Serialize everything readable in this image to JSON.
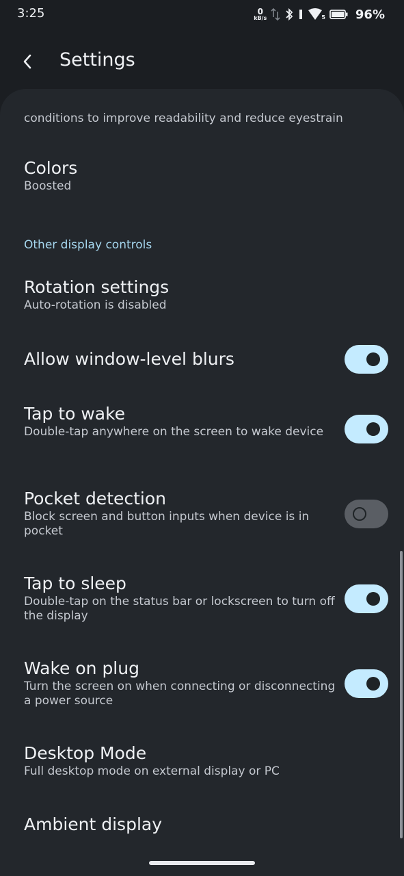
{
  "status_bar": {
    "time": "3:25",
    "net_speed_value": "0",
    "net_speed_unit": "kB/s",
    "signal_label": "5",
    "battery_percent": "96%"
  },
  "header": {
    "title": "Settings"
  },
  "top_description": "conditions to improve readability and reduce eyestrain",
  "items": {
    "colors": {
      "title": "Colors",
      "summary": "Boosted"
    },
    "section_other": "Other display controls",
    "rotation": {
      "title": "Rotation settings",
      "summary": "Auto-rotation is disabled"
    },
    "blurs": {
      "title": "Allow window-level blurs",
      "enabled": true
    },
    "tap_to_wake": {
      "title": "Tap to wake",
      "summary": "Double-tap anywhere on the screen to wake device",
      "enabled": true
    },
    "pocket": {
      "title": "Pocket detection",
      "summary": "Block screen and button inputs when device is in pocket",
      "enabled": false
    },
    "tap_to_sleep": {
      "title": "Tap to sleep",
      "summary": "Double-tap on the status bar or lockscreen to turn off the display",
      "enabled": true
    },
    "wake_on_plug": {
      "title": "Wake on plug",
      "summary": "Turn the screen on when connecting or disconnecting a power source",
      "enabled": true
    },
    "desktop_mode": {
      "title": "Desktop Mode",
      "summary": "Full desktop mode on external display or PC"
    },
    "ambient": {
      "title": "Ambient display"
    }
  },
  "colors": {
    "background": "#1b1e22",
    "panel": "#23272c",
    "accent": "#a5d6ee",
    "toggle_on": "#c4ebff",
    "toggle_off": "#5a5e64"
  }
}
